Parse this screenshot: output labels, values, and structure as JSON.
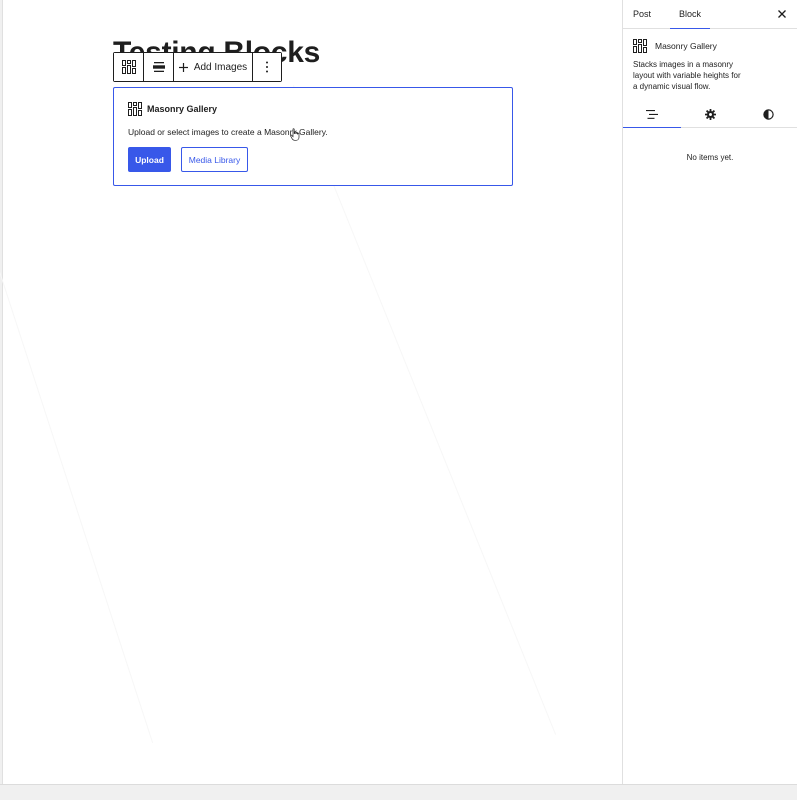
{
  "canvas": {
    "post_title": "Testing Blocks"
  },
  "block_toolbar": {
    "gallery_icon": "masonry-grid-icon",
    "align_icon": "align-wide-icon",
    "add_images_label": "Add Images",
    "more_icon": "vertical-ellipsis-icon"
  },
  "placeholder": {
    "title": "Masonry Gallery",
    "instructions": "Upload or select images to create a Masonry Gallery.",
    "upload_label": "Upload",
    "media_library_label": "Media Library"
  },
  "sidebar": {
    "tabs": [
      {
        "label": "Post",
        "active": false
      },
      {
        "label": "Block",
        "active": true
      }
    ],
    "close_icon": "close-icon",
    "block_card": {
      "title": "Masonry Gallery",
      "description": "Stacks images in a masonry layout with variable heights for a dynamic visual flow."
    },
    "subtabs": [
      {
        "icon": "list-view-icon",
        "active": true
      },
      {
        "icon": "gear-icon",
        "active": false
      },
      {
        "icon": "contrast-icon",
        "active": false
      }
    ],
    "empty_message": "No items yet."
  },
  "colors": {
    "accent": "#3858e9",
    "text": "#1e1e1e",
    "border": "#e0e0e0"
  }
}
